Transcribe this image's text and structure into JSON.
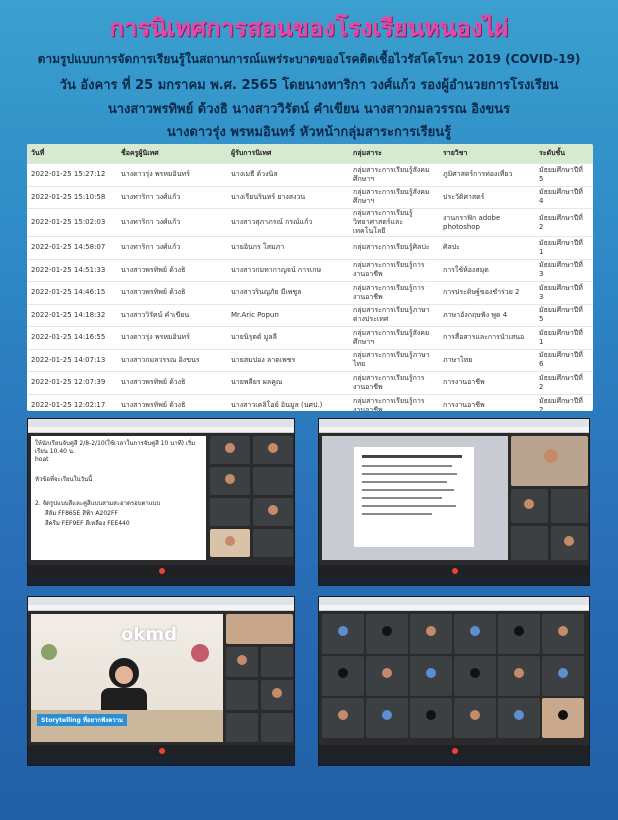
{
  "title": "การนิเทศการสอนของโรงเรียนหนองไผ่",
  "subtitle_lines": [
    "ตามรูปแบบการจัดการเรียนรู้ในสถานการณ์แพร่ระบาดของโรคติดเชื้อไวรัสโคโรนา 2019 (COVID-19)",
    "วัน อังคาร ที่ 25 มกราคม พ.ศ. 2565  โดยนางทาริกา วงศ์แก้ว รองผู้อำนวยการโรงเรียน",
    "นางสาวพรทิพย์ ด้วงธิ นางสาววิรัตน์ คำเขียน นางสาวกมลวรรณ อิงขนร",
    "นางดาวรุ่ง พรหมอินทร์ หัวหน้ากลุ่มสาระการเรียนรู้"
  ],
  "table": {
    "headers": [
      "วันที่",
      "ชื่อครูผู้นิเทศ",
      "ผู้รับการนิเทศ",
      "กลุ่มสาระ",
      "รายวิชา",
      "ระดับชั้น"
    ],
    "rows": [
      [
        "2022-01-25 15:27:12",
        "นางดาวรุ่ง พรหมอินทร์",
        "นางเมธี ด้วงนิล",
        "กลุ่มสาระการเรียนรู้สังคมศึกษาฯ",
        "ภูมิศาสตร์การท่องเที่ยว",
        "มัธยมศึกษาปีที่ 5"
      ],
      [
        "2022-01-25 15:10:58",
        "นางทาริกา วงศ์แก้ว",
        "นางเรียนรินทร์ ยางสงวน",
        "กลุ่มสาระการเรียนรู้สังคมศึกษาฯ",
        "ประวัติศาสตร์",
        "มัธยมศึกษาปีที่ 4"
      ],
      [
        "2022-01-25 15:02:03",
        "นางทาริกา วงศ์แก้ว",
        "นางสาวสุภาภรณ์ กรณ์แก้ว",
        "กลุ่มสาระการเรียนรู้วิทยาศาสตร์และเทคโนโลยี",
        "งานกราฟิก adobe photoshop",
        "มัธยมศึกษาปีที่ 2"
      ],
      [
        "2022-01-25 14:58:07",
        "นางทาริกา วงศ์แก้ว",
        "นายอินกร โสมภา",
        "กลุ่มสาระการเรียนรู้ศิลปะ",
        "ศิลปะ",
        "มัธยมศึกษาปีที่ 1"
      ],
      [
        "2022-01-25 14:51:33",
        "นางสาวพรทิพย์ ด้วงธิ",
        "นางสาวกมทากาญจน์ การเกษ",
        "กลุ่มสาระการเรียนรู้การงานอาชีพ",
        "การใช้ห้องสมุด",
        "มัธยมศึกษาปีที่ 3"
      ],
      [
        "2022-01-25 14:46:15",
        "นางสาวพรทิพย์ ด้วงธิ",
        "นางสาวรินญภัย มีเพชูล",
        "กลุ่มสาระการเรียนรู้การงานอาชีพ",
        "การประดิษฐ์ของชำร่วย 2",
        "มัธยมศึกษาปีที่ 3"
      ],
      [
        "2022-01-25 14:18:32",
        "นางสาววิรัตน์ คำเขียน",
        "Mr.Aric Popun",
        "กลุ่มสาระการเรียนรู้ภาษาต่างประเทศ",
        "ภาษาอังกฤษฟัง พูด 4",
        "มัธยมศึกษาปีที่ 5"
      ],
      [
        "2022-01-25 14:16:55",
        "นางดาวรุ่ง พรหมอินทร์",
        "นายนิรุตต์ มูลลี",
        "กลุ่มสาระการเรียนรู้สังคมศึกษาฯ",
        "การสื่อสารและการนำเสนอ",
        "มัธยมศึกษาปีที่ 1"
      ],
      [
        "2022-01-25 14:07:13",
        "นางสาวกมลวรรณ อิงขนร",
        "นายสมปอง ลาดเพชร",
        "กลุ่มสาระการเรียนรู้ภาษาไทย",
        "ภาษาไทย",
        "มัธยมศึกษาปีที่ 6"
      ],
      [
        "2022-01-25 12:07:39",
        "นางสาวพรทิพย์ ด้วงธิ",
        "นายพลียร ผลคูณ",
        "กลุ่มสาระการเรียนรู้การงานอาชีพ",
        "การงานอาชีพ",
        "มัธยมศึกษาปีที่ 2"
      ],
      [
        "2022-01-25 12:02:17",
        "นางสาวพรทิพย์ ด้วงธิ",
        "นางสาวเคลิโอย์ อินมูล (นศป.)",
        "กลุ่มสาระการเรียนรู้การงานอาชีพ",
        "การงานอาชีพ",
        "มัธยมศึกษาปีที่ 2"
      ]
    ]
  },
  "screenshot1": {
    "lines": [
      "ให้นักเรียนจับคู่สี 2/8-2/10(ใช้เวลาในการจับคู่สี 10 นาที) เริ่มเรียน 10.40 น.",
      "hoat",
      "หัวข้อที่จะเรียนในวันนี้",
      "2. จัดรูปแบบสีและคู่สีแบบสามสะอาดรอบตาแบบ",
      "สีส้ม FF865E  สีฟ้า A202FF",
      "สีครีม FEF9EF  สีเหลือง FEE440"
    ]
  },
  "screenshot3": {
    "logo": "okmd",
    "banner": "Storytelling ที่อยากฟังความ"
  }
}
